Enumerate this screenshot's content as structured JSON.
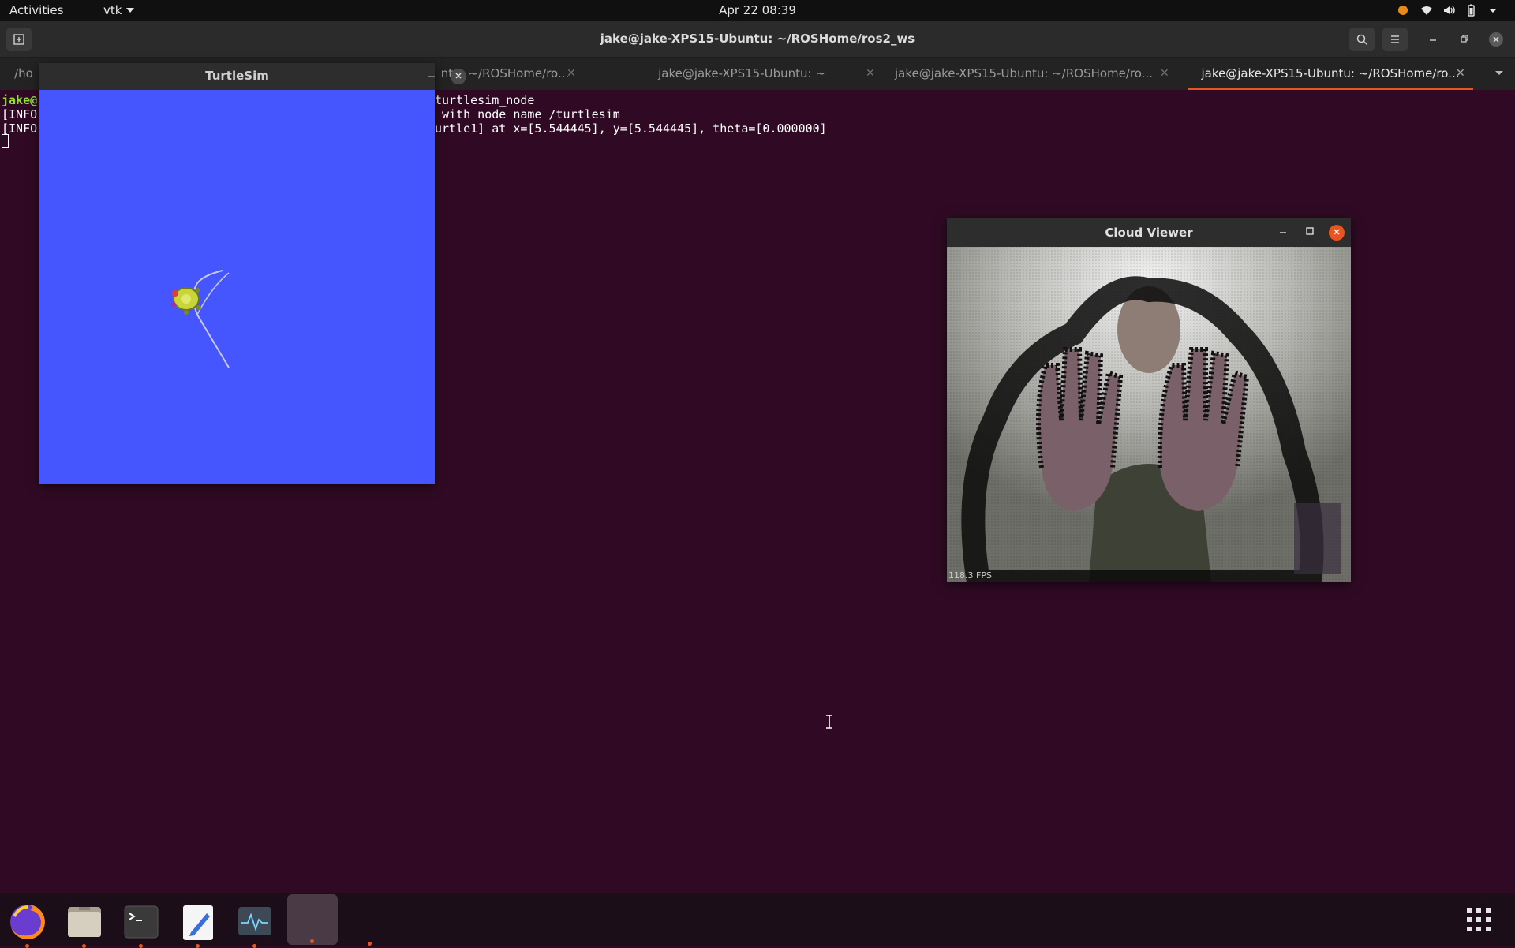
{
  "topbar": {
    "activities": "Activities",
    "app_menu": "vtk",
    "clock": "Apr 22  08:39",
    "tray_icons": [
      "update-indicator-icon",
      "wifi-icon",
      "volume-icon",
      "battery-icon",
      "power-menu-caret-icon"
    ]
  },
  "terminal": {
    "window_title": "jake@jake-XPS15-Ubuntu: ~/ROSHome/ros2_ws",
    "tabs": [
      {
        "label": "/ho"
      },
      {
        "label": "ntu: ~/ROSHome/ro..."
      },
      {
        "label": "jake@jake-XPS15-Ubuntu: ~"
      },
      {
        "label": "jake@jake-XPS15-Ubuntu: ~/ROSHome/ro..."
      },
      {
        "label": "jake@jake-XPS15-Ubuntu: ~/ROSHome/ro...",
        "active": true
      }
    ],
    "lines": {
      "prompt_user": "jake@",
      "line1": "turtlesim_node",
      "info2_prefix": "[INFO",
      "line2": " with node name /turtlesim",
      "info3_prefix": "[INFO",
      "line3": "urtle1] at x=[5.544445], y=[5.544445], theta=[0.000000]"
    }
  },
  "turtlesim": {
    "title": "TurtleSim",
    "background_color": "#4556ff"
  },
  "cloud_viewer": {
    "title": "Cloud Viewer",
    "fps": "118.3 FPS"
  },
  "dock": {
    "items": [
      "firefox-icon",
      "files-icon",
      "terminal-icon",
      "text-editor-icon",
      "system-monitor-icon",
      "vtk-app-icon"
    ],
    "show_apps": "show-applications-icon"
  },
  "colors": {
    "terminal_bg": "#300a24",
    "accent": "#e95420",
    "prompt_green": "#8ae234"
  }
}
